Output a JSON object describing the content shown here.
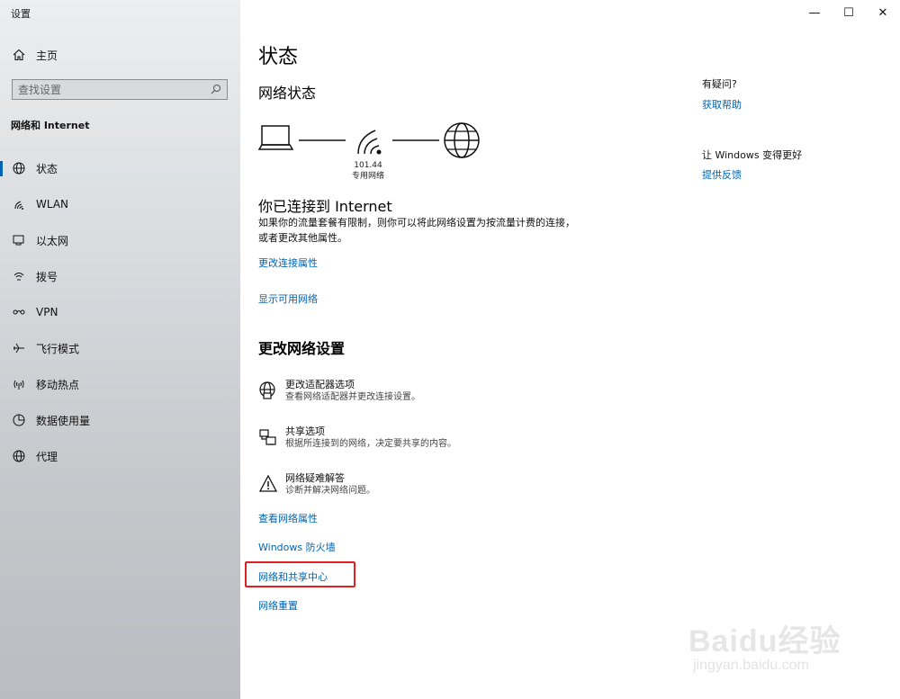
{
  "window": {
    "title": "设置",
    "controls": {
      "minimize": "—",
      "maximize": "☐",
      "close": "✕"
    }
  },
  "sidebar": {
    "home_label": "主页",
    "search_placeholder": "查找设置",
    "section_title": "网络和 Internet",
    "items": [
      {
        "label": "状态",
        "icon": "status-globe-icon",
        "active": true
      },
      {
        "label": "WLAN",
        "icon": "wifi-icon",
        "active": false
      },
      {
        "label": "以太网",
        "icon": "ethernet-icon",
        "active": false
      },
      {
        "label": "拨号",
        "icon": "dialup-icon",
        "active": false
      },
      {
        "label": "VPN",
        "icon": "vpn-icon",
        "active": false
      },
      {
        "label": "飞行模式",
        "icon": "airplane-icon",
        "active": false
      },
      {
        "label": "移动热点",
        "icon": "hotspot-icon",
        "active": false
      },
      {
        "label": "数据使用量",
        "icon": "data-usage-icon",
        "active": false
      },
      {
        "label": "代理",
        "icon": "proxy-icon",
        "active": false
      }
    ]
  },
  "main": {
    "title": "状态",
    "network_status_heading": "网络状态",
    "diagram": {
      "ip": "101.44",
      "network_type": "专用网络"
    },
    "connected_title": "你已连接到 Internet",
    "connected_desc": "如果你的流量套餐有限制，则你可以将此网络设置为按流量计费的连接，或者更改其他属性。",
    "links_top": {
      "change_properties": "更改连接属性",
      "show_networks": "显示可用网络"
    },
    "change_heading": "更改网络设置",
    "options": [
      {
        "title": "更改适配器选项",
        "desc": "查看网络适配器并更改连接设置。",
        "icon": "adapter-icon"
      },
      {
        "title": "共享选项",
        "desc": "根据所连接到的网络，决定要共享的内容。",
        "icon": "sharing-icon"
      },
      {
        "title": "网络疑难解答",
        "desc": "诊断并解决网络问题。",
        "icon": "warning-icon"
      }
    ],
    "links_bottom": {
      "view_properties": "查看网络属性",
      "firewall": "Windows 防火墙",
      "sharing_center": "网络和共享中心",
      "reset": "网络重置"
    }
  },
  "right_panel": {
    "question": "有疑问?",
    "get_help": "获取帮助",
    "make_better": "让 Windows 变得更好",
    "feedback": "提供反馈"
  },
  "watermark": {
    "brand": "Baidu经验",
    "url": "jingyan.baidu.com"
  },
  "colors": {
    "accent": "#0063b1",
    "highlight": "#e02020"
  }
}
